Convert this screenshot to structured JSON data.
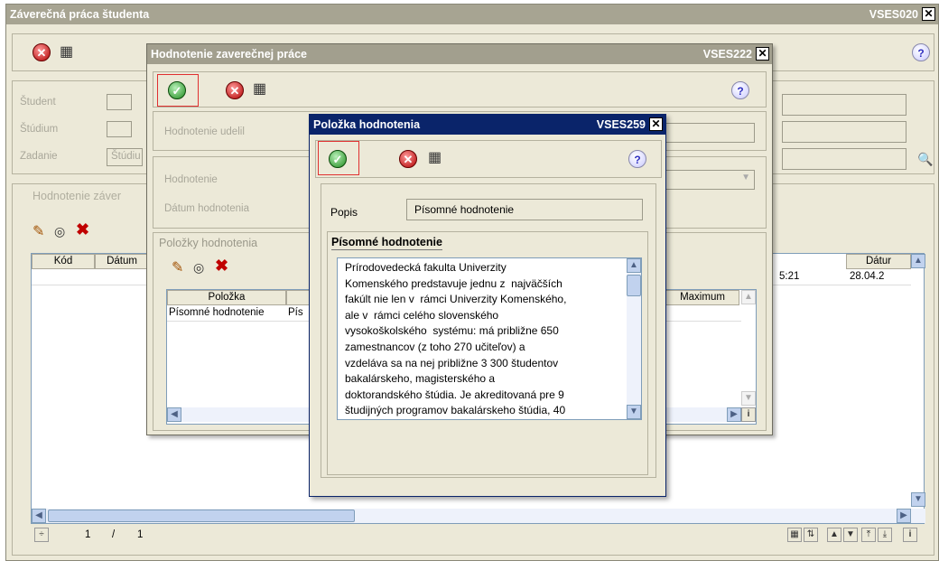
{
  "main": {
    "title": "Záverečná práca študenta",
    "code": "VSES020",
    "labels": {
      "student": "Študent",
      "studium": "Štúdium",
      "zadanie": "Zadanie",
      "zadanie_value": "Štúdiu"
    },
    "section_title": "Hodnotenie záver",
    "table_headers": [
      "Kód",
      "Dátum",
      "Dátur"
    ],
    "row_cells": [
      "5:21",
      "28.04.2"
    ],
    "pager": {
      "current": "1",
      "sep": "/",
      "total": "1"
    }
  },
  "mid": {
    "title": "Hodnotenie zaverečnej práce",
    "code": "VSES222",
    "labels": {
      "udelil": "Hodnotenie udelil",
      "hodnotenie": "Hodnotenie",
      "datum": "Dátum hodnotenia"
    },
    "section_title": "Položky hodnotenia",
    "table_headers": [
      "Položka",
      "Maximum"
    ],
    "rows": [
      {
        "polozka": "Písomné hodnotenie",
        "cut": "Pís"
      }
    ],
    "info_glyph": "i"
  },
  "dialog": {
    "title": "Položka hodnotenia",
    "code": "VSES259",
    "popis_label": "Popis",
    "popis_value": "Písomné hodnotenie",
    "group_title": "Písomné hodnotenie",
    "text_lines": [
      "Prírodovedecká fakulta Univerzity",
      "Komenského predstavuje jednu z  najväčších",
      "fakúlt nie len v  rámci Univerzity Komenského,",
      "ale v  rámci celého slovenského",
      "vysokoškolského  systému: má približne 650",
      "zamestnancov (z toho 270 učiteľov) a",
      "vzdeláva sa na nej približne 3 300 študentov",
      "bakalárskeho, magisterského a",
      "doktorandského štúdia. Je akreditovaná pre 9",
      "študijných programov bakalárskeho štúdia, 40"
    ]
  },
  "colors": {
    "main_title_bg": "#a7a492",
    "mid_title_bg": "#a29f8e",
    "dialog_title_bg": "#0a246a",
    "panel_bg": "#ece9d8"
  }
}
